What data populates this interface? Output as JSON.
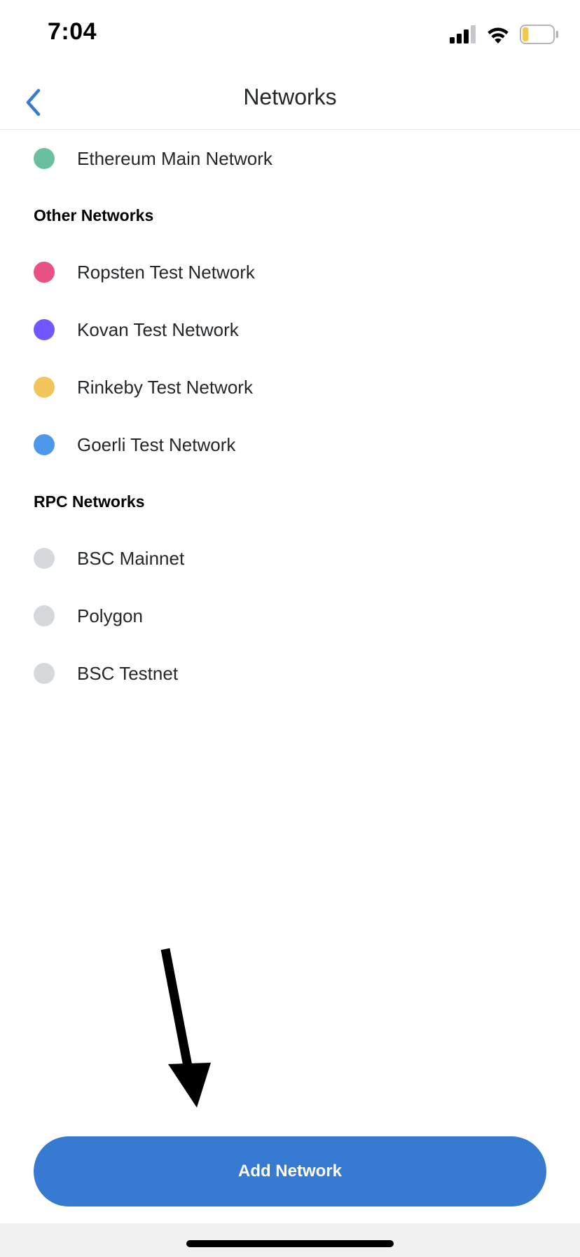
{
  "status_bar": {
    "time": "7:04",
    "icons": [
      "cellular-signal-icon",
      "wifi-icon",
      "battery-low-icon"
    ],
    "battery_fill_fraction": 0.2,
    "battery_fill_color": "#f2c94c"
  },
  "header": {
    "title": "Networks",
    "back_icon": "chevron-left-icon",
    "accent_color": "#377ad1"
  },
  "main_network": {
    "label": "Ethereum Main Network",
    "color": "#6ac09e"
  },
  "other_networks": {
    "heading": "Other Networks",
    "items": [
      {
        "label": "Ropsten Test Network",
        "color": "#e95083"
      },
      {
        "label": "Kovan Test Network",
        "color": "#7057ff"
      },
      {
        "label": "Rinkeby Test Network",
        "color": "#f2c55c"
      },
      {
        "label": "Goerli Test Network",
        "color": "#4e98ec"
      }
    ]
  },
  "rpc_networks": {
    "heading": "RPC Networks",
    "items": [
      {
        "label": "BSC Mainnet",
        "color": "#d6d9dc"
      },
      {
        "label": "Polygon",
        "color": "#d6d9dc"
      },
      {
        "label": "BSC Testnet",
        "color": "#d6d9dc"
      }
    ]
  },
  "annotation": {
    "icon": "arrow-down-icon"
  },
  "add_network": {
    "label": "Add Network",
    "color": "#377ad1"
  }
}
